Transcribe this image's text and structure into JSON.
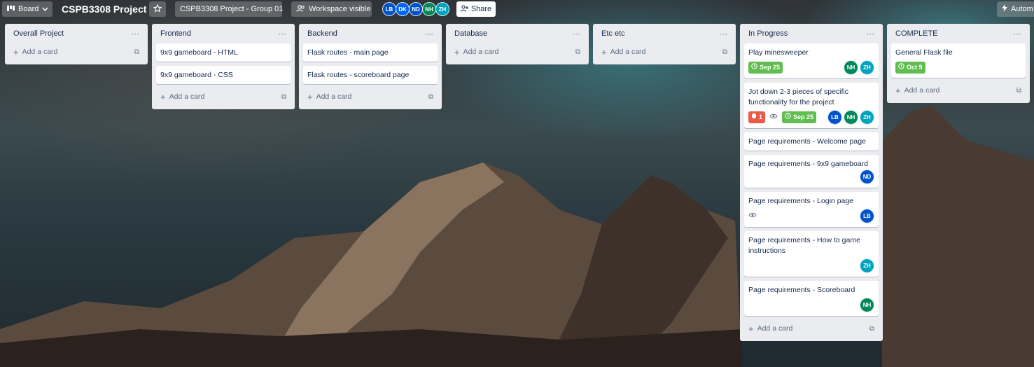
{
  "topbar": {
    "board_label": "Board",
    "title": "CSPB3308 Project",
    "workspace_label": "CSPB3308 Project - Group 01",
    "visibility_label": "Workspace visible",
    "members": [
      {
        "initials": "LB",
        "color": "#0052cc"
      },
      {
        "initials": "DK",
        "color": "#0065ff"
      },
      {
        "initials": "ND",
        "color": "#0052cc"
      },
      {
        "initials": "NH",
        "color": "#00875a"
      },
      {
        "initials": "ZH",
        "color": "#00a3bf"
      }
    ],
    "share_label": "Share",
    "automation_label": "Autom"
  },
  "lists": [
    {
      "title": "Overall Project",
      "cards": [],
      "add_label": "Add a card"
    },
    {
      "title": "Frontend",
      "cards": [
        {
          "text": "9x9 gameboard - HTML"
        },
        {
          "text": "9x9 gameboard - CSS"
        }
      ],
      "add_label": "Add a card"
    },
    {
      "title": "Backend",
      "cards": [
        {
          "text": "Flask routes - main page"
        },
        {
          "text": "Flask routes - scoreboard page"
        }
      ],
      "add_label": "Add a card"
    },
    {
      "title": "Database",
      "cards": [],
      "add_label": "Add a card"
    },
    {
      "title": "Etc etc",
      "cards": [],
      "add_label": "Add a card"
    },
    {
      "title": "In Progress",
      "cards": [
        {
          "text": "Play minesweeper",
          "due": "Sep 25",
          "members": [
            "NH",
            "ZH"
          ]
        },
        {
          "text": "Jot down 2-3 pieces of specific functionality for the project",
          "notifications": "1",
          "due": "Sep 25",
          "members": [
            "LB",
            "NH",
            "ZH"
          ]
        },
        {
          "text": "Page requirements - Welcome page"
        },
        {
          "text": "Page requirements - 9x9 gameboard",
          "members": [
            "ND"
          ]
        },
        {
          "text": "Page requirements - Login page",
          "members": [
            "LB"
          ]
        },
        {
          "text": "Page requirements - How to game instructions",
          "members": [
            "ZH"
          ]
        },
        {
          "text": "Page requirements - Scoreboard",
          "members": [
            "NH"
          ]
        }
      ],
      "add_label": "Add a card"
    },
    {
      "title": "COMPLETE",
      "cards": [
        {
          "text": "General Flask file",
          "due": "Oct 9"
        }
      ],
      "add_label": "Add a card"
    }
  ],
  "colors": {
    "due_green": "#61bd4f",
    "notification_red": "#eb5a46",
    "list_bg": "#ebecf0"
  }
}
